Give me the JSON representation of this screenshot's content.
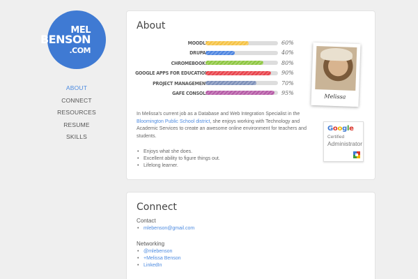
{
  "logo": {
    "line1": "MEL",
    "line2": "BENSON",
    "line3": ".COM"
  },
  "nav": [
    {
      "label": "ABOUT",
      "active": true
    },
    {
      "label": "CONNECT",
      "active": false
    },
    {
      "label": "RESOURCES",
      "active": false
    },
    {
      "label": "RESUME",
      "active": false
    },
    {
      "label": "SKILLS",
      "active": false
    }
  ],
  "about": {
    "title": "About",
    "skills": [
      {
        "name": "MOODLE",
        "percent_label": "60%",
        "value": 60,
        "color": "#f5c242"
      },
      {
        "name": "DRUPAL",
        "percent_label": "40%",
        "value": 40,
        "color": "#4c84e0"
      },
      {
        "name": "CHROMEBOOKS",
        "percent_label": "80%",
        "value": 80,
        "color": "#8cc63f"
      },
      {
        "name": "GOOGLE APPS FOR EDUCATION",
        "percent_label": "90%",
        "value": 90,
        "color": "#e8414a"
      },
      {
        "name": "PROJECT MANAGEMENT",
        "percent_label": "70%",
        "value": 70,
        "color": "#7c8fb8"
      },
      {
        "name": "GAFE CONSOLE",
        "percent_label": "95%",
        "value": 95,
        "color": "#b55aa6"
      }
    ],
    "photo_caption": "Melissa",
    "bio_before": "In Melissa's current job as a Database and Web Integration Specialist in the ",
    "bio_link": "Bloomington Public School district",
    "bio_after": ", she enjoys working with Technology and Academic Services to create an awesome online environment for teachers and students.",
    "bullets": [
      "Enjoys what she does.",
      "Excellent ability to figure things out.",
      "Lifelong learner."
    ],
    "badge": {
      "google": "Google",
      "certified": "Certified",
      "role": "Administrator"
    }
  },
  "connect": {
    "title": "Connect",
    "contact_heading": "Contact",
    "contact_links": [
      "mlebenson@gmail.com"
    ],
    "networking_heading": "Networking",
    "networking_links": [
      "@mlebenson",
      "+Melissa Benson",
      "LinkedIn"
    ]
  }
}
